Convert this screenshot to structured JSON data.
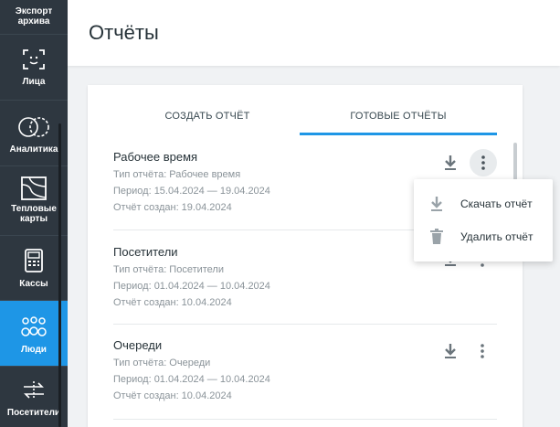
{
  "sidebar": {
    "items": [
      {
        "label": "Экспорт архива",
        "icon": "archive-icon"
      },
      {
        "label": "Лица",
        "icon": "face-scan-icon"
      },
      {
        "label": "Аналитика",
        "icon": "analytics-icon"
      },
      {
        "label": "Тепловые карты",
        "icon": "heatmap-icon"
      },
      {
        "label": "Кассы",
        "icon": "cash-register-icon"
      },
      {
        "label": "Люди",
        "icon": "people-icon",
        "active": true
      },
      {
        "label": "Посетители",
        "icon": "visitors-icon"
      }
    ]
  },
  "header": {
    "title": "Отчёты"
  },
  "tabs": [
    {
      "label": "СОЗДАТЬ ОТЧЁТ",
      "active": false
    },
    {
      "label": "ГОТОВЫЕ ОТЧЁТЫ",
      "active": true
    }
  ],
  "reports": [
    {
      "name": "Рабочее время",
      "type": "Тип отчёта: Рабочее время",
      "period": "Период: 15.04.2024 — 19.04.2024",
      "created": "Отчёт создан: 19.04.2024"
    },
    {
      "name": "Посетители",
      "type": "Тип отчёта: Посетители",
      "period": "Период: 01.04.2024 — 10.04.2024",
      "created": "Отчёт создан: 10.04.2024"
    },
    {
      "name": "Очереди",
      "type": "Тип отчёта: Очереди",
      "period": "Период: 01.04.2024 — 10.04.2024",
      "created": "Отчёт создан: 10.04.2024"
    }
  ],
  "menu": {
    "download": "Скачать отчёт",
    "delete": "Удалить отчёт"
  },
  "colors": {
    "accent": "#1e96e6",
    "sidebar": "#2e3740"
  }
}
